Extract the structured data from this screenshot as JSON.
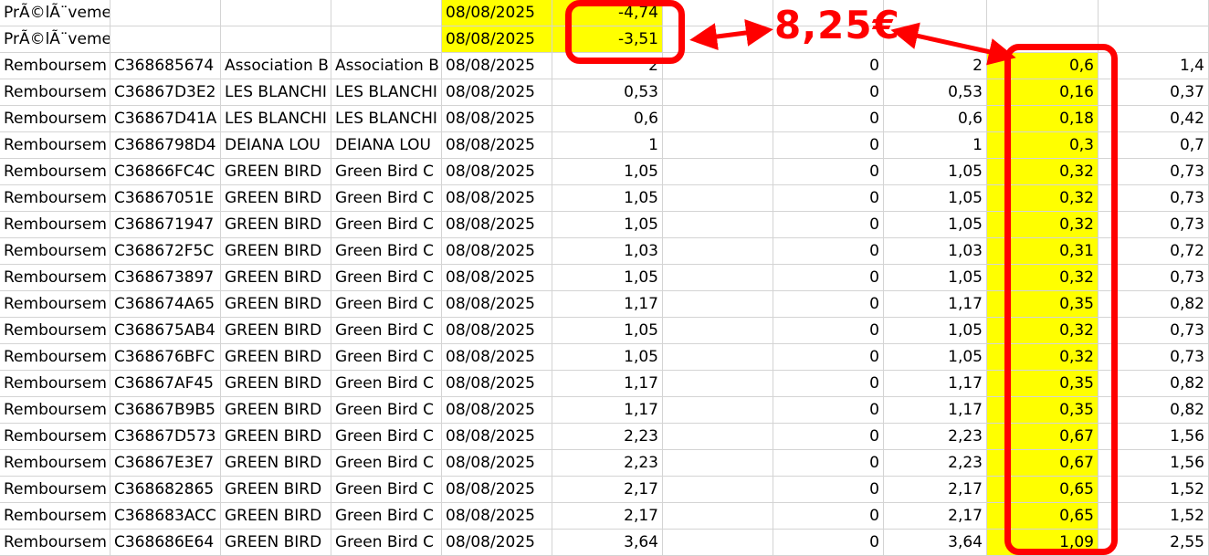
{
  "annotation": {
    "text": "8,25€",
    "color": "#ff0000"
  },
  "highlight_color": "#ffff00",
  "rows": [
    {
      "c0": "PrÃ©lÃ¨vements fiscaux",
      "c1": "",
      "c2": "",
      "c3": "",
      "c4": "08/08/2025",
      "c5": "-4,74",
      "c6": "",
      "c7": "",
      "c8": "",
      "c9": "",
      "c10": ""
    },
    {
      "c0": "PrÃ©lÃ¨vements fiscaux",
      "c1": "",
      "c2": "",
      "c3": "",
      "c4": "08/08/2025",
      "c5": "-3,51",
      "c6": "",
      "c7": "",
      "c8": "",
      "c9": "",
      "c10": ""
    },
    {
      "c0": "Remboursem",
      "c1": "C368685674",
      "c2": "Association B",
      "c3": "Association B",
      "c4": "08/08/2025",
      "c5": "2",
      "c6": "",
      "c7": "0",
      "c8": "2",
      "c9": "0,6",
      "c10": "1,4"
    },
    {
      "c0": "Remboursem",
      "c1": "C36867D3E2",
      "c2": "LES BLANCHI",
      "c3": "LES BLANCHI",
      "c4": "08/08/2025",
      "c5": "0,53",
      "c6": "",
      "c7": "0",
      "c8": "0,53",
      "c9": "0,16",
      "c10": "0,37"
    },
    {
      "c0": "Remboursem",
      "c1": "C36867D41A",
      "c2": "LES BLANCHI",
      "c3": "LES BLANCHI",
      "c4": "08/08/2025",
      "c5": "0,6",
      "c6": "",
      "c7": "0",
      "c8": "0,6",
      "c9": "0,18",
      "c10": "0,42"
    },
    {
      "c0": "Remboursem",
      "c1": "C3686798D4",
      "c2": "DEIANA LOU",
      "c3": "DEIANA LOU",
      "c4": "08/08/2025",
      "c5": "1",
      "c6": "",
      "c7": "0",
      "c8": "1",
      "c9": "0,3",
      "c10": "0,7"
    },
    {
      "c0": "Remboursem",
      "c1": "C36866FC4C",
      "c2": "GREEN BIRD",
      "c3": "Green Bird C",
      "c4": "08/08/2025",
      "c5": "1,05",
      "c6": "",
      "c7": "0",
      "c8": "1,05",
      "c9": "0,32",
      "c10": "0,73"
    },
    {
      "c0": "Remboursem",
      "c1": "C36867051E",
      "c2": "GREEN BIRD",
      "c3": "Green Bird C",
      "c4": "08/08/2025",
      "c5": "1,05",
      "c6": "",
      "c7": "0",
      "c8": "1,05",
      "c9": "0,32",
      "c10": "0,73"
    },
    {
      "c0": "Remboursem",
      "c1": "C368671947",
      "c2": "GREEN BIRD",
      "c3": "Green Bird C",
      "c4": "08/08/2025",
      "c5": "1,05",
      "c6": "",
      "c7": "0",
      "c8": "1,05",
      "c9": "0,32",
      "c10": "0,73"
    },
    {
      "c0": "Remboursem",
      "c1": "C368672F5C",
      "c2": "GREEN BIRD",
      "c3": "Green Bird C",
      "c4": "08/08/2025",
      "c5": "1,03",
      "c6": "",
      "c7": "0",
      "c8": "1,03",
      "c9": "0,31",
      "c10": "0,72"
    },
    {
      "c0": "Remboursem",
      "c1": "C368673897",
      "c2": "GREEN BIRD",
      "c3": "Green Bird C",
      "c4": "08/08/2025",
      "c5": "1,05",
      "c6": "",
      "c7": "0",
      "c8": "1,05",
      "c9": "0,32",
      "c10": "0,73"
    },
    {
      "c0": "Remboursem",
      "c1": "C368674A65",
      "c2": "GREEN BIRD",
      "c3": "Green Bird C",
      "c4": "08/08/2025",
      "c5": "1,17",
      "c6": "",
      "c7": "0",
      "c8": "1,17",
      "c9": "0,35",
      "c10": "0,82"
    },
    {
      "c0": "Remboursem",
      "c1": "C368675AB4",
      "c2": "GREEN BIRD",
      "c3": "Green Bird C",
      "c4": "08/08/2025",
      "c5": "1,05",
      "c6": "",
      "c7": "0",
      "c8": "1,05",
      "c9": "0,32",
      "c10": "0,73"
    },
    {
      "c0": "Remboursem",
      "c1": "C368676BFC",
      "c2": "GREEN BIRD",
      "c3": "Green Bird C",
      "c4": "08/08/2025",
      "c5": "1,05",
      "c6": "",
      "c7": "0",
      "c8": "1,05",
      "c9": "0,32",
      "c10": "0,73"
    },
    {
      "c0": "Remboursem",
      "c1": "C36867AF45",
      "c2": "GREEN BIRD",
      "c3": "Green Bird C",
      "c4": "08/08/2025",
      "c5": "1,17",
      "c6": "",
      "c7": "0",
      "c8": "1,17",
      "c9": "0,35",
      "c10": "0,82"
    },
    {
      "c0": "Remboursem",
      "c1": "C36867B9B5",
      "c2": "GREEN BIRD",
      "c3": "Green Bird C",
      "c4": "08/08/2025",
      "c5": "1,17",
      "c6": "",
      "c7": "0",
      "c8": "1,17",
      "c9": "0,35",
      "c10": "0,82"
    },
    {
      "c0": "Remboursem",
      "c1": "C36867D573",
      "c2": "GREEN BIRD",
      "c3": "Green Bird C",
      "c4": "08/08/2025",
      "c5": "2,23",
      "c6": "",
      "c7": "0",
      "c8": "2,23",
      "c9": "0,67",
      "c10": "1,56"
    },
    {
      "c0": "Remboursem",
      "c1": "C36867E3E7",
      "c2": "GREEN BIRD",
      "c3": "Green Bird C",
      "c4": "08/08/2025",
      "c5": "2,23",
      "c6": "",
      "c7": "0",
      "c8": "2,23",
      "c9": "0,67",
      "c10": "1,56"
    },
    {
      "c0": "Remboursem",
      "c1": "C368682865",
      "c2": "GREEN BIRD",
      "c3": "Green Bird C",
      "c4": "08/08/2025",
      "c5": "2,17",
      "c6": "",
      "c7": "0",
      "c8": "2,17",
      "c9": "0,65",
      "c10": "1,52"
    },
    {
      "c0": "Remboursem",
      "c1": "C368683ACC",
      "c2": "GREEN BIRD",
      "c3": "Green Bird C",
      "c4": "08/08/2025",
      "c5": "2,17",
      "c6": "",
      "c7": "0",
      "c8": "2,17",
      "c9": "0,65",
      "c10": "1,52"
    },
    {
      "c0": "Remboursem",
      "c1": "C368686E64",
      "c2": "GREEN BIRD",
      "c3": "Green Bird C",
      "c4": "08/08/2025",
      "c5": "3,64",
      "c6": "",
      "c7": "0",
      "c8": "3,64",
      "c9": "1,09",
      "c10": "2,55"
    }
  ]
}
